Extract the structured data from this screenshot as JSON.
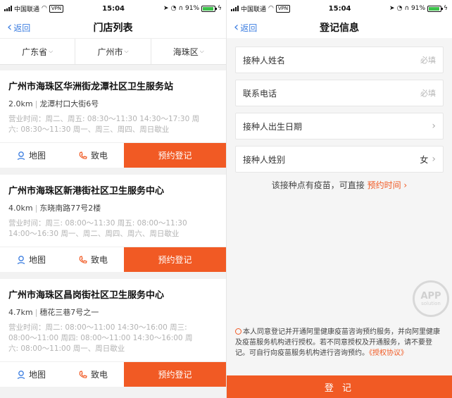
{
  "status_bar": {
    "carrier": "中国联通",
    "vpn": "VPN",
    "time": "15:04",
    "battery": "91%",
    "battery_level": 0.91
  },
  "left_screen": {
    "back_label": "返回",
    "title": "门店列表",
    "filters": [
      "广东省",
      "广州市",
      "海珠区"
    ],
    "stores": [
      {
        "name": "广州市海珠区华洲街龙潭社区卫生服务站",
        "distance": "2.0km",
        "address": "龙潭村口大街6号",
        "hours_line1": "营业时间：周二、周五: 08:30～11:30 14:30～17:30 周",
        "hours_line2": "六: 08:30～11:30 周一、周三、周四、周日歇业"
      },
      {
        "name": "广州市海珠区新港街社区卫生服务中心",
        "distance": "4.0km",
        "address": "东晓南路77号2楼",
        "hours_line1": "营业时间：周三: 08:00～11:30 周五: 08:00～11:30",
        "hours_line2": "14:00～16:30 周一、周二、周四、周六、周日歇业"
      },
      {
        "name": "广州市海珠区昌岗街社区卫生服务中心",
        "distance": "4.7km",
        "address": "穗花三巷7号之一",
        "hours_line1": "营业时间：周二: 08:00～11:00 14:30～16:00 周三:",
        "hours_line2": "08:00～11:00 周四: 08:00～11:00 14:30～16:00 周",
        "hours_line3": "六: 08:00～11:00 周一、周日歇业"
      }
    ],
    "actions": {
      "map": "地图",
      "call": "致电",
      "book": "预约登记"
    }
  },
  "right_screen": {
    "back_label": "返回",
    "title": "登记信息",
    "fields": [
      {
        "label": "接种人姓名",
        "hint": "必填",
        "value": ""
      },
      {
        "label": "联系电话",
        "hint": "必填",
        "value": ""
      },
      {
        "label": "接种人出生日期",
        "hint": "",
        "value": ""
      },
      {
        "label": "接种人姓别",
        "hint": "",
        "value": "女"
      }
    ],
    "notice_text": "该接种点有疫苗，可直接",
    "notice_link": "预约时间",
    "watermark_big": "APP",
    "watermark_small": "solution",
    "agreement_text": "本人同意登记并开通阿里健康疫苗咨询预约服务，并向阿里健康及疫苗服务机构进行授权。若不同意授权及开通服务，请不要登记。可自行向疫苗服务机构进行咨询预约。",
    "agreement_link": "《授权协议》",
    "submit_label": "登 记"
  },
  "colors": {
    "accent": "#f15a24",
    "link_blue": "#3b7de0",
    "battery_green": "#3cc24a"
  },
  "icons": [
    "back-chevron-icon",
    "map-pin-icon",
    "phone-icon",
    "chevron-right-icon",
    "caret-down-icon"
  ]
}
